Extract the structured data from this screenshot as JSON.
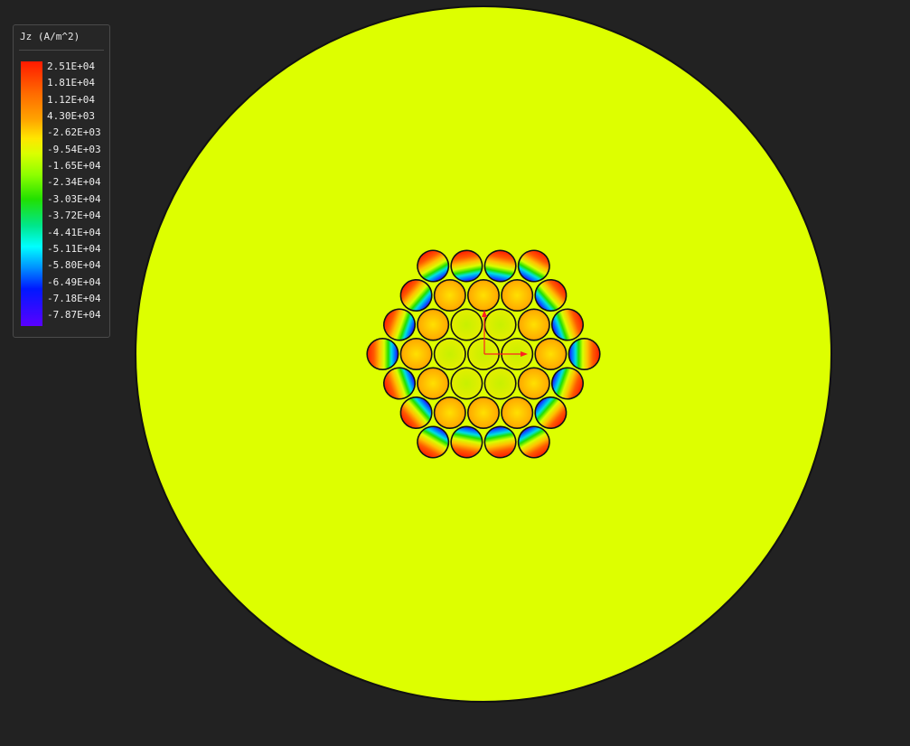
{
  "legend": {
    "title": "Jz (A/m^2)",
    "labels": [
      "2.51E+04",
      "1.81E+04",
      "1.12E+04",
      "4.30E+03",
      "-2.62E+03",
      "-9.54E+03",
      "-1.65E+04",
      "-2.34E+04",
      "-3.03E+04",
      "-3.72E+04",
      "-4.41E+04",
      "-5.11E+04",
      "-5.80E+04",
      "-6.49E+04",
      "-7.18E+04",
      "-7.87E+04"
    ]
  },
  "colors": {
    "background": "#222222",
    "domain_fill": "#ddff00",
    "outline": "#111111",
    "axis": "#ff2020"
  },
  "conductors": {
    "rings": 3,
    "strands": 37
  }
}
